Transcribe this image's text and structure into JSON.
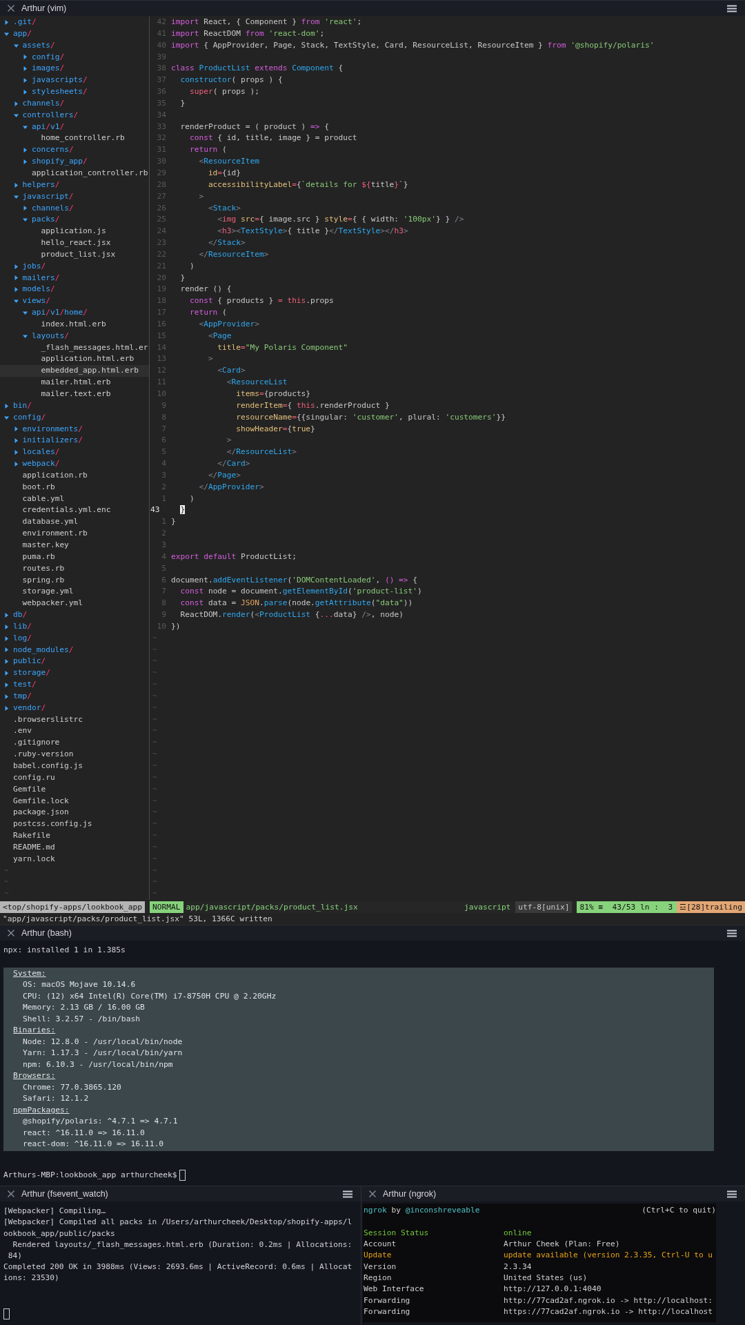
{
  "vim": {
    "title": "Arthur (vim)",
    "tree": [
      {
        "name": ".git/",
        "kind": "dir",
        "expanded": false,
        "selected": false
      },
      {
        "name": "app/",
        "kind": "dir",
        "expanded": true,
        "selected": false,
        "children": [
          {
            "name": "assets/",
            "kind": "dir",
            "expanded": true,
            "selected": false,
            "children": [
              {
                "name": "config/",
                "kind": "dir",
                "expanded": false,
                "selected": false
              },
              {
                "name": "images/",
                "kind": "dir",
                "expanded": false,
                "selected": false
              },
              {
                "name": "javascripts/",
                "kind": "dir",
                "expanded": false,
                "selected": false
              },
              {
                "name": "stylesheets/",
                "kind": "dir",
                "expanded": false,
                "selected": false
              }
            ]
          },
          {
            "name": "channels/",
            "kind": "dir",
            "expanded": false,
            "selected": false
          },
          {
            "name": "controllers/",
            "kind": "dir",
            "expanded": true,
            "selected": false,
            "children": [
              {
                "name": "api/v1/",
                "kind": "dir",
                "expanded": true,
                "selected": false,
                "children": [
                  {
                    "name": "home_controller.rb",
                    "kind": "file",
                    "selected": false
                  }
                ]
              },
              {
                "name": "concerns/",
                "kind": "dir",
                "expanded": false,
                "selected": false
              },
              {
                "name": "shopify_app/",
                "kind": "dir",
                "expanded": false,
                "selected": false
              },
              {
                "name": "application_controller.rb",
                "kind": "file",
                "selected": false
              }
            ]
          },
          {
            "name": "helpers/",
            "kind": "dir",
            "expanded": false,
            "selected": false
          },
          {
            "name": "javascript/",
            "kind": "dir",
            "expanded": true,
            "selected": false,
            "children": [
              {
                "name": "channels/",
                "kind": "dir",
                "expanded": false,
                "selected": false
              },
              {
                "name": "packs/",
                "kind": "dir",
                "expanded": true,
                "selected": false,
                "children": [
                  {
                    "name": "application.js",
                    "kind": "file",
                    "selected": false
                  },
                  {
                    "name": "hello_react.jsx",
                    "kind": "file",
                    "selected": false
                  },
                  {
                    "name": "product_list.jsx",
                    "kind": "file",
                    "selected": false
                  }
                ]
              }
            ]
          },
          {
            "name": "jobs/",
            "kind": "dir",
            "expanded": false,
            "selected": false
          },
          {
            "name": "mailers/",
            "kind": "dir",
            "expanded": false,
            "selected": false
          },
          {
            "name": "models/",
            "kind": "dir",
            "expanded": false,
            "selected": false
          },
          {
            "name": "views/",
            "kind": "dir",
            "expanded": true,
            "selected": false,
            "children": [
              {
                "name": "api/v1/home/",
                "kind": "dir",
                "expanded": true,
                "selected": false,
                "children": [
                  {
                    "name": "index.html.erb",
                    "kind": "file",
                    "selected": false
                  }
                ]
              },
              {
                "name": "layouts/",
                "kind": "dir",
                "expanded": true,
                "selected": false,
                "children": [
                  {
                    "name": "_flash_messages.html.er",
                    "kind": "file",
                    "selected": false
                  },
                  {
                    "name": "application.html.erb",
                    "kind": "file",
                    "selected": false
                  },
                  {
                    "name": "embedded_app.html.erb",
                    "kind": "file",
                    "selected": true
                  },
                  {
                    "name": "mailer.html.erb",
                    "kind": "file",
                    "selected": false
                  },
                  {
                    "name": "mailer.text.erb",
                    "kind": "file",
                    "selected": false
                  }
                ]
              }
            ]
          }
        ]
      },
      {
        "name": "bin/",
        "kind": "dir",
        "expanded": false,
        "selected": false
      },
      {
        "name": "config/",
        "kind": "dir",
        "expanded": true,
        "selected": false,
        "children": [
          {
            "name": "environments/",
            "kind": "dir",
            "expanded": false,
            "selected": false
          },
          {
            "name": "initializers/",
            "kind": "dir",
            "expanded": false,
            "selected": false
          },
          {
            "name": "locales/",
            "kind": "dir",
            "expanded": false,
            "selected": false
          },
          {
            "name": "webpack/",
            "kind": "dir",
            "expanded": false,
            "selected": false
          },
          {
            "name": "application.rb",
            "kind": "file",
            "selected": false
          },
          {
            "name": "boot.rb",
            "kind": "file",
            "selected": false
          },
          {
            "name": "cable.yml",
            "kind": "file",
            "selected": false
          },
          {
            "name": "credentials.yml.enc",
            "kind": "file",
            "selected": false
          },
          {
            "name": "database.yml",
            "kind": "file",
            "selected": false
          },
          {
            "name": "environment.rb",
            "kind": "file",
            "selected": false
          },
          {
            "name": "master.key",
            "kind": "file",
            "selected": false
          },
          {
            "name": "puma.rb",
            "kind": "file",
            "selected": false
          },
          {
            "name": "routes.rb",
            "kind": "file",
            "selected": false
          },
          {
            "name": "spring.rb",
            "kind": "file",
            "selected": false
          },
          {
            "name": "storage.yml",
            "kind": "file",
            "selected": false
          },
          {
            "name": "webpacker.yml",
            "kind": "file",
            "selected": false
          }
        ]
      },
      {
        "name": "db/",
        "kind": "dir",
        "expanded": false,
        "selected": false
      },
      {
        "name": "lib/",
        "kind": "dir",
        "expanded": false,
        "selected": false
      },
      {
        "name": "log/",
        "kind": "dir",
        "expanded": false,
        "selected": false
      },
      {
        "name": "node_modules/",
        "kind": "dir",
        "expanded": false,
        "selected": false
      },
      {
        "name": "public/",
        "kind": "dir",
        "expanded": false,
        "selected": false
      },
      {
        "name": "storage/",
        "kind": "dir",
        "expanded": false,
        "selected": false
      },
      {
        "name": "test/",
        "kind": "dir",
        "expanded": false,
        "selected": false
      },
      {
        "name": "tmp/",
        "kind": "dir",
        "expanded": false,
        "selected": false
      },
      {
        "name": "vendor/",
        "kind": "dir",
        "expanded": false,
        "selected": false
      },
      {
        "name": ".browserslistrc",
        "kind": "file",
        "selected": false
      },
      {
        "name": ".env",
        "kind": "file",
        "selected": false
      },
      {
        "name": ".gitignore",
        "kind": "file",
        "selected": false
      },
      {
        "name": ".ruby-version",
        "kind": "file",
        "selected": false
      },
      {
        "name": "babel.config.js",
        "kind": "file",
        "selected": false
      },
      {
        "name": "config.ru",
        "kind": "file",
        "selected": false
      },
      {
        "name": "Gemfile",
        "kind": "file",
        "selected": false
      },
      {
        "name": "Gemfile.lock",
        "kind": "file",
        "selected": false
      },
      {
        "name": "package.json",
        "kind": "file",
        "selected": false
      },
      {
        "name": "postcss.config.js",
        "kind": "file",
        "selected": false
      },
      {
        "name": "Rakefile",
        "kind": "file",
        "selected": false
      },
      {
        "name": "README.md",
        "kind": "file",
        "selected": false
      },
      {
        "name": "yarn.lock",
        "kind": "file",
        "selected": false
      }
    ],
    "tree_filler": [
      "~",
      "~",
      "~"
    ],
    "lines": [
      {
        "number": "42",
        "current": false,
        "tokens": [
          {
            "text": "import",
            "kind": "kw"
          },
          {
            "text": " React, { Component } ",
            "kind": "plain"
          },
          {
            "text": "from ",
            "kind": "kw"
          },
          {
            "text": "'react'",
            "kind": "str"
          },
          {
            "text": ";",
            "kind": "plain"
          }
        ]
      },
      {
        "number": "41",
        "current": false,
        "tokens": [
          {
            "text": "import",
            "kind": "kw"
          },
          {
            "text": " ReactDOM ",
            "kind": "plain"
          },
          {
            "text": "from ",
            "kind": "kw"
          },
          {
            "text": "'react-dom'",
            "kind": "str"
          },
          {
            "text": ";",
            "kind": "plain"
          }
        ]
      },
      {
        "number": "40",
        "current": false,
        "tokens": [
          {
            "text": "import",
            "kind": "kw"
          },
          {
            "text": " { AppProvider, Page, Stack, TextStyle, Card, ResourceList, ResourceItem } ",
            "kind": "plain"
          },
          {
            "text": "from ",
            "kind": "kw"
          },
          {
            "text": "'@shopify/polaris'",
            "kind": "str"
          }
        ]
      },
      {
        "number": "39",
        "current": false
      },
      {
        "number": "38",
        "current": false,
        "tokens": [
          {
            "text": "class ",
            "kind": "kw"
          },
          {
            "text": "ProductList ",
            "kind": "type"
          },
          {
            "text": "extends ",
            "kind": "kw"
          },
          {
            "text": "Component",
            "kind": "type"
          },
          {
            "text": " {",
            "kind": "plain"
          }
        ]
      },
      {
        "number": "37",
        "current": false,
        "tokens": [
          {
            "text": "  constructor",
            "kind": "type"
          },
          {
            "text": "( props ) {",
            "kind": "plain"
          }
        ]
      },
      {
        "number": "36",
        "current": false,
        "tokens": [
          {
            "text": "    super",
            "kind": "var"
          },
          {
            "text": "( props );",
            "kind": "plain"
          }
        ]
      },
      {
        "number": "35",
        "current": false,
        "tokens": [
          {
            "text": "  }",
            "kind": "plain"
          }
        ]
      },
      {
        "number": "34",
        "current": false
      },
      {
        "number": "33",
        "current": false,
        "tokens": [
          {
            "text": "  renderProduct = ( product ) ",
            "kind": "plain"
          },
          {
            "text": "=>",
            "kind": "kw"
          },
          {
            "text": " {",
            "kind": "plain"
          }
        ]
      },
      {
        "number": "32",
        "current": false,
        "tokens": [
          {
            "text": "    const",
            "kind": "kw"
          },
          {
            "text": " { id, title, image } = product",
            "kind": "plain"
          }
        ]
      },
      {
        "number": "31",
        "current": false,
        "tokens": [
          {
            "text": "    return",
            "kind": "kw"
          },
          {
            "text": " (",
            "kind": "plain"
          }
        ]
      },
      {
        "number": "30",
        "current": false,
        "tokens": [
          {
            "text": "      <",
            "kind": "punct"
          },
          {
            "text": "ResourceItem",
            "kind": "type"
          }
        ]
      },
      {
        "number": "29",
        "current": false,
        "tokens": [
          {
            "text": "        id",
            "kind": "attr"
          },
          {
            "text": "=",
            "kind": "var"
          },
          {
            "text": "{id}",
            "kind": "plain"
          }
        ]
      },
      {
        "number": "28",
        "current": false,
        "tokens": [
          {
            "text": "        accessibilityLabel",
            "kind": "attr"
          },
          {
            "text": "=",
            "kind": "var"
          },
          {
            "text": "{",
            "kind": "plain"
          },
          {
            "text": "`details for ",
            "kind": "str"
          },
          {
            "text": "${",
            "kind": "var"
          },
          {
            "text": "title",
            "kind": "plain"
          },
          {
            "text": "}",
            "kind": "var"
          },
          {
            "text": "`",
            "kind": "str"
          },
          {
            "text": "}",
            "kind": "plain"
          }
        ]
      },
      {
        "number": "27",
        "current": false,
        "tokens": [
          {
            "text": "      >",
            "kind": "punct"
          }
        ]
      },
      {
        "number": "26",
        "current": false,
        "tokens": [
          {
            "text": "        <",
            "kind": "punct"
          },
          {
            "text": "Stack",
            "kind": "type"
          },
          {
            "text": ">",
            "kind": "punct"
          }
        ]
      },
      {
        "number": "25",
        "current": false,
        "tokens": [
          {
            "text": "          <",
            "kind": "punct"
          },
          {
            "text": "img ",
            "kind": "var"
          },
          {
            "text": "src",
            "kind": "attr"
          },
          {
            "text": "=",
            "kind": "var"
          },
          {
            "text": "{ image.src } ",
            "kind": "plain"
          },
          {
            "text": "style",
            "kind": "attr"
          },
          {
            "text": "=",
            "kind": "var"
          },
          {
            "text": "{ { width: ",
            "kind": "plain"
          },
          {
            "text": "'100px'",
            "kind": "str"
          },
          {
            "text": "} } ",
            "kind": "plain"
          },
          {
            "text": "/>",
            "kind": "punct"
          }
        ]
      },
      {
        "number": "24",
        "current": false,
        "tokens": [
          {
            "text": "          <",
            "kind": "punct"
          },
          {
            "text": "h3",
            "kind": "var"
          },
          {
            "text": "><",
            "kind": "punct"
          },
          {
            "text": "TextStyle",
            "kind": "type"
          },
          {
            "text": ">",
            "kind": "punct"
          },
          {
            "text": "{ title }",
            "kind": "plain"
          },
          {
            "text": "</",
            "kind": "punct"
          },
          {
            "text": "TextStyle",
            "kind": "type"
          },
          {
            "text": "></",
            "kind": "punct"
          },
          {
            "text": "h3",
            "kind": "var"
          },
          {
            "text": ">",
            "kind": "punct"
          }
        ]
      },
      {
        "number": "23",
        "current": false,
        "tokens": [
          {
            "text": "        </",
            "kind": "punct"
          },
          {
            "text": "Stack",
            "kind": "type"
          },
          {
            "text": ">",
            "kind": "punct"
          }
        ]
      },
      {
        "number": "22",
        "current": false,
        "tokens": [
          {
            "text": "      </",
            "kind": "punct"
          },
          {
            "text": "ResourceItem",
            "kind": "type"
          },
          {
            "text": ">",
            "kind": "punct"
          }
        ]
      },
      {
        "number": "21",
        "current": false,
        "tokens": [
          {
            "text": "    )",
            "kind": "plain"
          }
        ]
      },
      {
        "number": "20",
        "current": false,
        "tokens": [
          {
            "text": "  }",
            "kind": "plain"
          }
        ]
      },
      {
        "number": "19",
        "current": false,
        "tokens": [
          {
            "text": "  render () {",
            "kind": "plain"
          }
        ]
      },
      {
        "number": "18",
        "current": false,
        "tokens": [
          {
            "text": "    const",
            "kind": "kw"
          },
          {
            "text": " { products } ",
            "kind": "plain"
          },
          {
            "text": "= this",
            "kind": "var"
          },
          {
            "text": ".props",
            "kind": "plain"
          }
        ]
      },
      {
        "number": "17",
        "current": false,
        "tokens": [
          {
            "text": "    return",
            "kind": "kw"
          },
          {
            "text": " (",
            "kind": "plain"
          }
        ]
      },
      {
        "number": "16",
        "current": false,
        "tokens": [
          {
            "text": "      <",
            "kind": "punct"
          },
          {
            "text": "AppProvider",
            "kind": "type"
          },
          {
            "text": ">",
            "kind": "punct"
          }
        ]
      },
      {
        "number": "15",
        "current": false,
        "tokens": [
          {
            "text": "        <",
            "kind": "punct"
          },
          {
            "text": "Page",
            "kind": "type"
          }
        ]
      },
      {
        "number": "14",
        "current": false,
        "tokens": [
          {
            "text": "          title",
            "kind": "attr"
          },
          {
            "text": "=",
            "kind": "var"
          },
          {
            "text": "\"My Polaris Component\"",
            "kind": "str"
          }
        ]
      },
      {
        "number": "13",
        "current": false,
        "tokens": [
          {
            "text": "        >",
            "kind": "punct"
          }
        ]
      },
      {
        "number": "12",
        "current": false,
        "tokens": [
          {
            "text": "          <",
            "kind": "punct"
          },
          {
            "text": "Card",
            "kind": "type"
          },
          {
            "text": ">",
            "kind": "punct"
          }
        ]
      },
      {
        "number": "11",
        "current": false,
        "tokens": [
          {
            "text": "            <",
            "kind": "punct"
          },
          {
            "text": "ResourceList",
            "kind": "type"
          }
        ]
      },
      {
        "number": "10",
        "current": false,
        "tokens": [
          {
            "text": "              items",
            "kind": "attr"
          },
          {
            "text": "=",
            "kind": "var"
          },
          {
            "text": "{products}",
            "kind": "plain"
          }
        ]
      },
      {
        "number": "9",
        "current": false,
        "tokens": [
          {
            "text": "              renderItem",
            "kind": "attr"
          },
          {
            "text": "=",
            "kind": "var"
          },
          {
            "text": "{ ",
            "kind": "plain"
          },
          {
            "text": "this",
            "kind": "var"
          },
          {
            "text": ".renderProduct }",
            "kind": "plain"
          }
        ]
      },
      {
        "number": "8",
        "current": false,
        "tokens": [
          {
            "text": "              resourceName",
            "kind": "attr"
          },
          {
            "text": "=",
            "kind": "var"
          },
          {
            "text": "{{singular: ",
            "kind": "plain"
          },
          {
            "text": "'customer'",
            "kind": "str"
          },
          {
            "text": ", plural: ",
            "kind": "plain"
          },
          {
            "text": "'customers'",
            "kind": "str"
          },
          {
            "text": "}}",
            "kind": "plain"
          }
        ]
      },
      {
        "number": "7",
        "current": false,
        "tokens": [
          {
            "text": "              showHeader",
            "kind": "attr"
          },
          {
            "text": "=",
            "kind": "var"
          },
          {
            "text": "{",
            "kind": "plain"
          },
          {
            "text": "true",
            "kind": "attr"
          },
          {
            "text": "}",
            "kind": "plain"
          }
        ]
      },
      {
        "number": "6",
        "current": false,
        "tokens": [
          {
            "text": "            >",
            "kind": "punct"
          }
        ]
      },
      {
        "number": "5",
        "current": false,
        "tokens": [
          {
            "text": "            </",
            "kind": "punct"
          },
          {
            "text": "ResourceList",
            "kind": "type"
          },
          {
            "text": ">",
            "kind": "punct"
          }
        ]
      },
      {
        "number": "4",
        "current": false,
        "tokens": [
          {
            "text": "          </",
            "kind": "punct"
          },
          {
            "text": "Card",
            "kind": "type"
          },
          {
            "text": ">",
            "kind": "punct"
          }
        ]
      },
      {
        "number": "3",
        "current": false,
        "tokens": [
          {
            "text": "        </",
            "kind": "punct"
          },
          {
            "text": "Page",
            "kind": "type"
          },
          {
            "text": ">",
            "kind": "punct"
          }
        ]
      },
      {
        "number": "2",
        "current": false,
        "tokens": [
          {
            "text": "      </",
            "kind": "punct"
          },
          {
            "text": "AppProvider",
            "kind": "type"
          },
          {
            "text": ">",
            "kind": "punct"
          }
        ]
      },
      {
        "number": "1",
        "current": false,
        "tokens": [
          {
            "text": "    )",
            "kind": "plain"
          }
        ]
      },
      {
        "number": "43",
        "current": true,
        "tokens": [
          {
            "text": "  }",
            "kind": "cursor"
          }
        ]
      },
      {
        "number": "1",
        "current": false,
        "tokens": [
          {
            "text": "}",
            "kind": "plain"
          }
        ]
      },
      {
        "number": "2",
        "current": false
      },
      {
        "number": "3",
        "current": false
      },
      {
        "number": "4",
        "current": false,
        "tokens": [
          {
            "text": "export ",
            "kind": "kw"
          },
          {
            "text": "default",
            "kind": "kw"
          },
          {
            "text": " ProductList;",
            "kind": "plain"
          }
        ]
      },
      {
        "number": "5",
        "current": false
      },
      {
        "number": "6",
        "current": false,
        "tokens": [
          {
            "text": "document.",
            "kind": "plain"
          },
          {
            "text": "addEventListener",
            "kind": "type"
          },
          {
            "text": "(",
            "kind": "plain"
          },
          {
            "text": "'DOMContentLoaded'",
            "kind": "str"
          },
          {
            "text": ", ",
            "kind": "plain"
          },
          {
            "text": "() =>",
            "kind": "kw"
          },
          {
            "text": " {",
            "kind": "plain"
          }
        ]
      },
      {
        "number": "7",
        "current": false,
        "tokens": [
          {
            "text": "  const",
            "kind": "kw"
          },
          {
            "text": " node = document.",
            "kind": "plain"
          },
          {
            "text": "getElementById",
            "kind": "type"
          },
          {
            "text": "(",
            "kind": "plain"
          },
          {
            "text": "'product-list'",
            "kind": "str"
          },
          {
            "text": ")",
            "kind": "plain"
          }
        ]
      },
      {
        "number": "8",
        "current": false,
        "tokens": [
          {
            "text": "  const",
            "kind": "kw"
          },
          {
            "text": " data = ",
            "kind": "plain"
          },
          {
            "text": "JSON",
            "kind": "builtin"
          },
          {
            "text": ".",
            "kind": "plain"
          },
          {
            "text": "parse",
            "kind": "type"
          },
          {
            "text": "(node.",
            "kind": "plain"
          },
          {
            "text": "getAttribute",
            "kind": "type"
          },
          {
            "text": "(",
            "kind": "plain"
          },
          {
            "text": "\"data\"",
            "kind": "str"
          },
          {
            "text": "))",
            "kind": "plain"
          }
        ]
      },
      {
        "number": "9",
        "current": false,
        "tokens": [
          {
            "text": "  ReactDOM.",
            "kind": "plain"
          },
          {
            "text": "render",
            "kind": "type"
          },
          {
            "text": "(",
            "kind": "plain"
          },
          {
            "text": "<",
            "kind": "punct"
          },
          {
            "text": "ProductList",
            "kind": "type"
          },
          {
            "text": " {",
            "kind": "plain"
          },
          {
            "text": "...",
            "kind": "var"
          },
          {
            "text": "data} ",
            "kind": "plain"
          },
          {
            "text": "/>",
            "kind": "punct"
          },
          {
            "text": ", node)",
            "kind": "plain"
          }
        ]
      },
      {
        "number": "10",
        "current": false,
        "tokens": [
          {
            "text": "})",
            "kind": "plain"
          }
        ]
      }
    ],
    "filler": [
      "~",
      "~",
      "~",
      "~",
      "~",
      "~",
      "~",
      "~",
      "~",
      "~",
      "~",
      "~",
      "~",
      "~",
      "~",
      "~",
      "~",
      "~",
      "~",
      "~",
      "~",
      "~",
      "~"
    ],
    "status": [
      {
        "text": "<top/shopify-apps/lookbook_app",
        "kind": "cwd"
      },
      {
        "text": "NORMAL",
        "kind": "mode"
      },
      {
        "text": "app/javascript/packs/product_list.jsx",
        "kind": "file"
      },
      {
        "text": "javascript",
        "kind": "filetype"
      },
      {
        "text": "utf-8[unix]",
        "kind": "encoding"
      },
      {
        "text": "81% ≡  43/53 ln :  3",
        "kind": "position"
      },
      {
        "text": "☲[28]trailing",
        "kind": "warning"
      }
    ],
    "message": "\"app/javascript/packs/product_list.jsx\" 53L, 1366C written"
  },
  "bash": {
    "title": "Arthur (bash)",
    "output": [
      "npx: installed 1 in 1.385s"
    ],
    "report": [
      {
        "text": "System:",
        "kind": "heading"
      },
      {
        "text": "OS: macOS Mojave 10.14.6",
        "kind": "item"
      },
      {
        "text": "CPU: (12) x64 Intel(R) Core(TM) i7-8750H CPU @ 2.20GHz",
        "kind": "item"
      },
      {
        "text": "Memory: 2.13 GB / 16.00 GB",
        "kind": "item"
      },
      {
        "text": "Shell: 3.2.57 - /bin/bash",
        "kind": "item"
      },
      {
        "text": "Binaries:",
        "kind": "heading"
      },
      {
        "text": "Node: 12.8.0 - /usr/local/bin/node",
        "kind": "item"
      },
      {
        "text": "Yarn: 1.17.3 - /usr/local/bin/yarn",
        "kind": "item"
      },
      {
        "text": "npm: 6.10.3 - /usr/local/bin/npm",
        "kind": "item"
      },
      {
        "text": "Browsers:",
        "kind": "heading"
      },
      {
        "text": "Chrome: 77.0.3865.120",
        "kind": "item"
      },
      {
        "text": "Safari: 12.1.2",
        "kind": "item"
      },
      {
        "text": "npmPackages:",
        "kind": "heading"
      },
      {
        "text": "@shopify/polaris: ^4.7.1 => 4.7.1",
        "kind": "item"
      },
      {
        "text": "react: ^16.11.0 => 16.11.0",
        "kind": "item"
      },
      {
        "text": "react-dom: ^16.11.0 => 16.11.0",
        "kind": "item"
      }
    ],
    "prompt": "Arthurs-MBP:lookbook_app arthurcheek$"
  },
  "fsevent": {
    "title": "Arthur (fsevent_watch)",
    "lines": [
      "[Webpacker] Compiling…",
      "[Webpacker] Compiled all packs in /Users/arthurcheek/Desktop/shopify-apps/l",
      "ookbook_app/public/packs",
      "  Rendered layouts/_flash_messages.html.erb (Duration: 0.2ms | Allocations:",
      " 84)",
      "Completed 200 OK in 3988ms (Views: 2693.6ms | ActiveRecord: 0.6ms | Allocat",
      "ions: 23530)"
    ]
  },
  "ngrok": {
    "title": "Arthur (ngrok)",
    "banner": [
      {
        "text": "ngrok",
        "kind": "accent"
      },
      {
        "text": "by",
        "kind": "plain"
      },
      {
        "text": "@inconshreveable",
        "kind": "accent"
      }
    ],
    "hint": "(Ctrl+C to quit)",
    "rows": [
      {
        "label": "Session Status",
        "value": "online",
        "kind": "ok"
      },
      {
        "label": "Account",
        "value": "Arthur Cheek (Plan: Free)",
        "kind": "plain"
      },
      {
        "label": "Update",
        "value": "update available (version 2.3.35, Ctrl-U to u",
        "kind": "warn"
      },
      {
        "label": "Version",
        "value": "2.3.34",
        "kind": "plain"
      },
      {
        "label": "Region",
        "value": "United States (us)",
        "kind": "plain"
      },
      {
        "label": "Web Interface",
        "value": "http://127.0.0.1:4040",
        "kind": "plain"
      },
      {
        "label": "Forwarding",
        "value": "http://77cad2af.ngrok.io -> http://localhost:",
        "kind": "plain"
      },
      {
        "label": "Forwarding",
        "value": "https://77cad2af.ngrok.io -> http://localhost",
        "kind": "plain"
      }
    ]
  }
}
